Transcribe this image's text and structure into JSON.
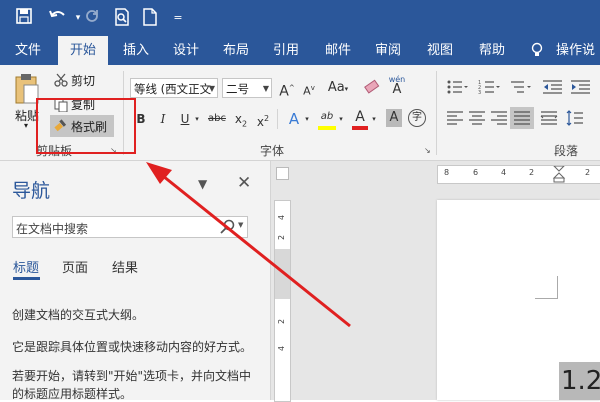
{
  "qat": {
    "save_icon": "save-icon",
    "undo_icon": "undo-icon",
    "redo_icon": "redo-icon",
    "preview_icon": "print-preview-icon",
    "new_icon": "new-document-icon",
    "customize_icon": "customize-qat-icon"
  },
  "tabs": [
    "文件",
    "开始",
    "插入",
    "设计",
    "布局",
    "引用",
    "邮件",
    "审阅",
    "视图",
    "帮助",
    "操作说"
  ],
  "active_tab": "开始",
  "ribbon": {
    "paste_label": "粘贴",
    "cut_label": "剪切",
    "copy_label": "复制",
    "format_painter_label": "格式刷",
    "clipboard_group": "剪贴板",
    "font_name": "等线 (西文正文",
    "font_size": "二号",
    "grow_font": "A",
    "shrink_font": "A",
    "change_case": "Aa",
    "phonetic": "wén",
    "phonetic_char": "A",
    "bold": "B",
    "italic": "I",
    "underline": "U",
    "strike": "abc",
    "subscript": "x",
    "subscript_sub": "2",
    "superscript": "x",
    "superscript_sup": "2",
    "text_effect": "A",
    "highlight": "ab",
    "font_color": "A",
    "char_shading": "A",
    "enclose": "字",
    "font_group": "字体",
    "paragraph_group": "段落",
    "colors": {
      "font_color": "#e02020",
      "highlight": "#ffff00",
      "brand": "#2b579a"
    }
  },
  "navpane": {
    "title": "导航",
    "search_placeholder": "在文档中搜索",
    "tabs": [
      "标题",
      "页面",
      "结果"
    ],
    "lines": [
      "创建文档的交互式大纲。",
      "它是跟踪具体位置或快速移动内容的好方式。",
      "若要开始，请转到\"开始\"选项卡，并向文档中",
      "的标题应用标题样式。"
    ]
  },
  "ruler": {
    "h_ticks": [
      "8",
      "6",
      "4",
      "2",
      "2"
    ],
    "v_ticks": [
      "4",
      "2",
      "2",
      "4"
    ]
  },
  "document": {
    "zoom_text": "1.2"
  }
}
